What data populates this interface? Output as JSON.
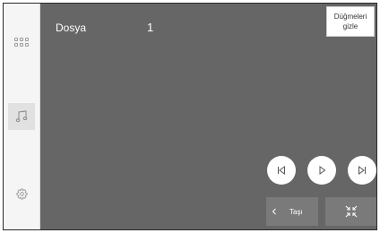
{
  "sidebar": {
    "items": [
      {
        "icon": "grid-icon",
        "active": false
      },
      {
        "icon": "music-note-icon",
        "active": true
      },
      {
        "icon": "gear-icon",
        "active": false
      }
    ]
  },
  "main": {
    "source_label": "Dosya",
    "track_number": "1"
  },
  "hide_buttons_label": "Düğmeleri gizle",
  "controls": {
    "previous_icon": "skip-previous-icon",
    "play_icon": "play-icon",
    "next_icon": "skip-next-icon"
  },
  "bottom": {
    "move_label": "Taşı",
    "move_icon": "chevron-left-icon",
    "shrink_icon": "shrink-icon"
  },
  "colors": {
    "background": "#666666",
    "sidebar": "#f5f5f5",
    "button_bg": "#7a7a7a",
    "active_item": "#e1e1e1"
  }
}
